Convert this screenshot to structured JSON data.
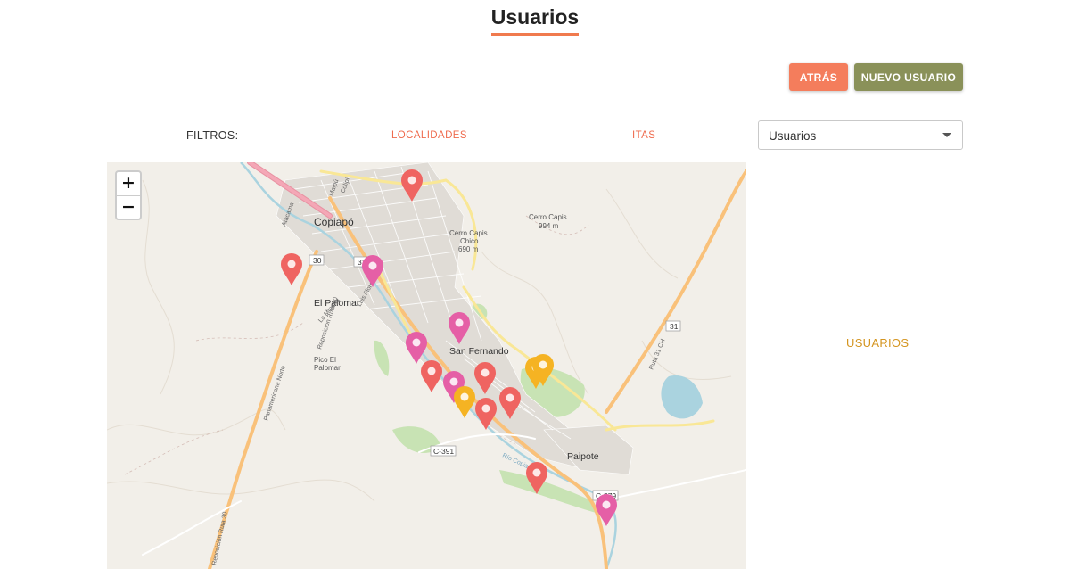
{
  "page": {
    "title": "Usuarios"
  },
  "buttons": {
    "back": "ATRÁS",
    "new_user": "NUEVO USUARIO"
  },
  "filters": {
    "label": "FILTROS:",
    "localidades": "LOCALIDADES",
    "itas": "ITAS"
  },
  "select": {
    "value": "Usuarios"
  },
  "map": {
    "zoom_in": "+",
    "zoom_out": "−",
    "labels": {
      "copiapo": "Copiapó",
      "el_palomar": "El Palomar",
      "san_fernando": "San Fernando",
      "paipote": "Paipote",
      "pico_el_palomar_1": "Pico El",
      "pico_el_palomar_2": "Palomar",
      "cerro_capis_chico_1": "Cerro Capis",
      "cerro_capis_chico_2": "Chico",
      "cerro_capis_chico_3": "690 m",
      "cerro_capis_1": "Cerro Capis",
      "cerro_capis_2": "994 m",
      "route_30": "30",
      "route_31a": "31",
      "route_31b": "31",
      "c391": "C-391",
      "c379": "C-379",
      "panamericana": "Panamericana Norte",
      "reposicion_ruta_30": "Reposición Ruta 30",
      "reposicion_ruta_30_b": "Reposición Ruta 30",
      "la_mineria": "La Minería",
      "luis_flores": "Luis Flores",
      "ruta_31ch": "Ruta 31 CH",
      "rio_copiapo": "Río Copiapó",
      "maipu": "Maipú",
      "colipi": "Colipí",
      "atacama": "Atacama"
    }
  },
  "side": {
    "label": "USUARIOS"
  },
  "colors": {
    "accent": "#f07a4e",
    "pin_red": "#ef6461",
    "pin_pink": "#e55fa6",
    "pin_orange": "#f5b323",
    "btn_back": "#f47d5c",
    "btn_new": "#8a9159"
  }
}
